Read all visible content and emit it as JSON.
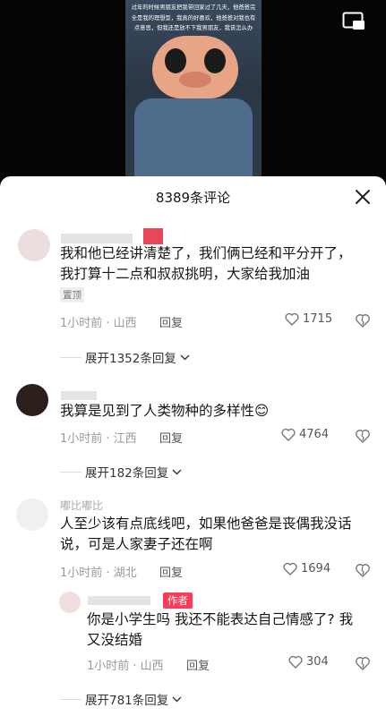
{
  "video": {
    "caption": "过年的时候男朋友把我带回家过了几天，他爸爸完全是我的理想型，我真的好喜欢，他爸爸对我也有点意思，但我还是放不下我男朋友，我该怎么办"
  },
  "header": {
    "title": "8389条评论"
  },
  "comments": [
    {
      "text": "我和他已经讲清楚了，我们俩已经和平分开了，我打算十二点和叔叔挑明，大家给我加油",
      "pinned": "置顶",
      "time": "1小时前 · 山西",
      "reply": "回复",
      "likes": "1715",
      "expand": "展开1352条回复"
    },
    {
      "text": "我算是见到了人类物种的多样性😊",
      "time": "1小时前 · 江西",
      "reply": "回复",
      "likes": "4764",
      "expand": "展开182条回复"
    },
    {
      "username": "嘟比嘟比",
      "text": "人至少该有点底线吧，如果他爸爸是丧偶我没话说，可是人家妻子还在啊",
      "time": "1小时前 · 湖北",
      "reply": "回复",
      "likes": "1694"
    }
  ],
  "subreply": {
    "author": "作者",
    "text": "你是小学生吗 我还不能表达自己情感了? 我又没结婚",
    "time": "1小时前 · 山西",
    "reply": "回复",
    "likes": "304",
    "expand": "展开781条回复"
  }
}
